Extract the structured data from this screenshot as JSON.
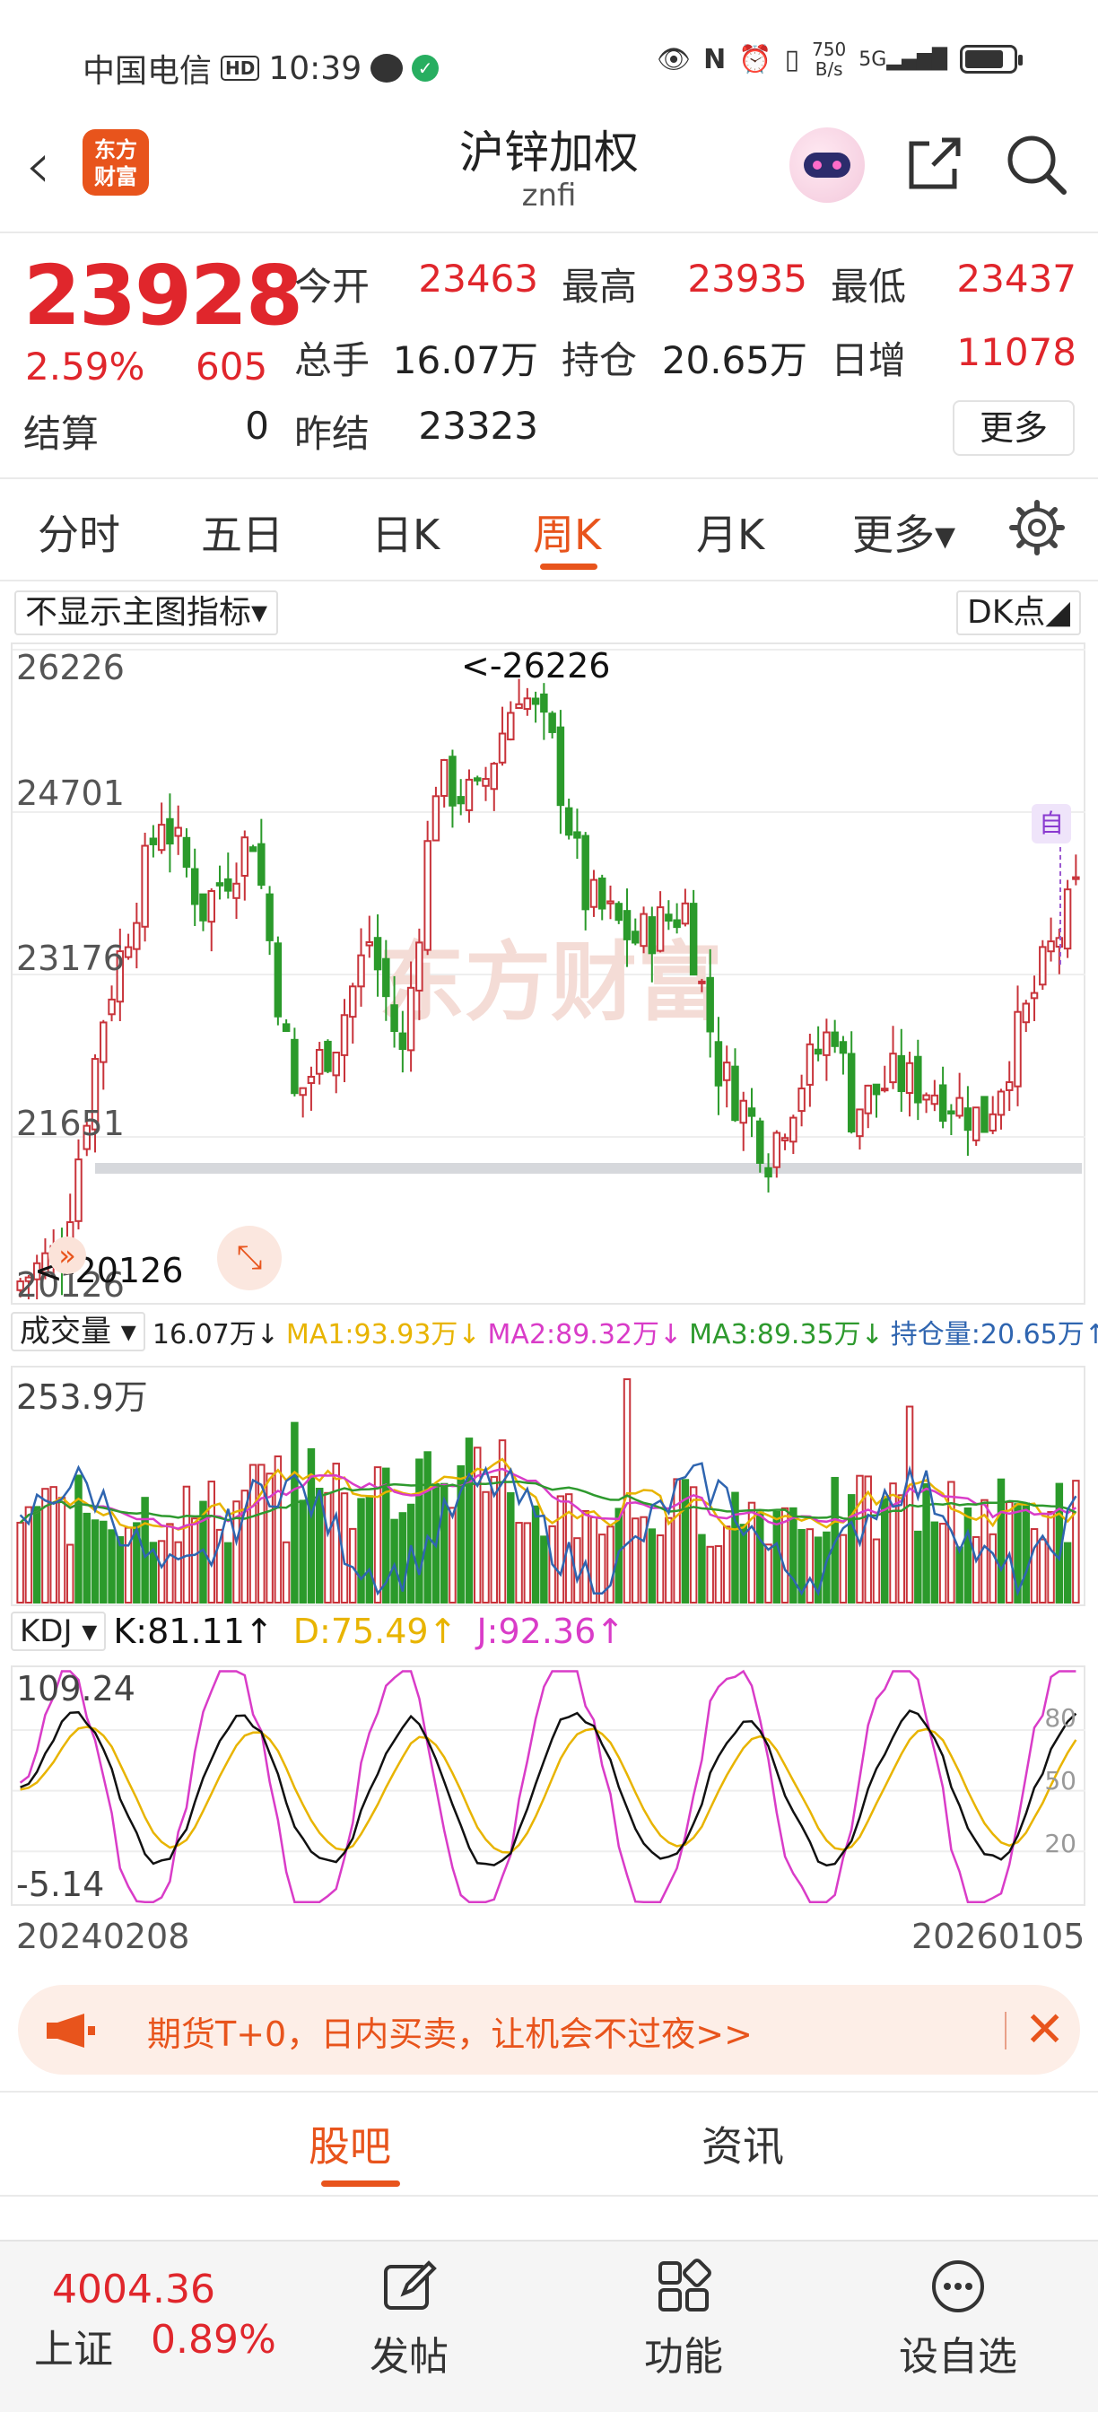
{
  "status_bar": {
    "carrier": "中国电信",
    "hd": "HD",
    "time": "10:39",
    "net_speed_value": "750",
    "net_speed_unit": "B/s",
    "signal_label": "5G"
  },
  "header": {
    "back_icon": "back-arrow-icon",
    "logo_text_line1": "东方",
    "logo_text_line2": "财富",
    "title": "沪锌加权",
    "subtitle": "znfi"
  },
  "quote": {
    "price": "23928",
    "change_pct": "2.59%",
    "change": "605",
    "open_label": "今开",
    "open": "23463",
    "high_label": "最高",
    "high": "23935",
    "low_label": "最低",
    "low": "23437",
    "volume_label": "总手",
    "volume": "16.07万",
    "oi_label": "持仓",
    "oi": "20.65万",
    "daily_inc_label": "日增",
    "daily_inc": "11078",
    "settle_label": "结算",
    "settle": "0",
    "prev_settle_label": "昨结",
    "prev_settle": "23323",
    "more_label": "更多"
  },
  "tabs": [
    {
      "label": "分时"
    },
    {
      "label": "五日"
    },
    {
      "label": "日K"
    },
    {
      "label": "周K",
      "active": true
    },
    {
      "label": "月K"
    },
    {
      "label": "更多▾"
    }
  ],
  "main_chart": {
    "indicator_dropdown": "不显示主图指标▾",
    "dk_label": "DK点◢",
    "y_ticks": [
      "26226",
      "24701",
      "23176",
      "21651",
      "20126"
    ],
    "high_annotation": "<-26226",
    "low_annotation": "<-20126",
    "self_marker": "自",
    "watermark": "东方财富"
  },
  "volume_panel": {
    "dropdown": "成交量 ▾",
    "vol": "16.07万↓",
    "ma1": "MA1:93.93万↓",
    "ma2": "MA2:89.32万↓",
    "ma3": "MA3:89.35万↓",
    "oi": "持仓量:20.65万↑",
    "y_top": "253.9万",
    "colors": {
      "ma1": "#e8b400",
      "ma2": "#d93cc8",
      "ma3": "#2e9a2e",
      "oi": "#2f65b0"
    }
  },
  "kdj_panel": {
    "dropdown": "KDJ ▾",
    "k": "K:81.11↑",
    "d": "D:75.49↑",
    "j": "J:92.36↑",
    "y_top": "109.24",
    "y_bottom": "-5.14",
    "levels": [
      "80",
      "50",
      "20"
    ]
  },
  "dates": {
    "start": "20240208",
    "end": "20260105"
  },
  "banner": {
    "text": "期货T+0，日内买卖，让机会不过夜>>",
    "close": "✕"
  },
  "subtabs": [
    {
      "label": "股吧",
      "active": true
    },
    {
      "label": "资讯"
    }
  ],
  "bottom_bar": {
    "index_value": "4004.36",
    "index_name": "上证",
    "index_pct": "0.89%",
    "items": [
      {
        "label": "发帖",
        "icon": "edit-icon"
      },
      {
        "label": "功能",
        "icon": "grid-icon"
      },
      {
        "label": "设自选",
        "icon": "more-circle-icon"
      }
    ]
  },
  "chart_data": [
    {
      "type": "candlestick",
      "title": "",
      "ylim": [
        20126,
        26226
      ],
      "x_range": [
        "20240208",
        "20260105"
      ],
      "annotations": [
        {
          "text": "<-26226",
          "value": 26226
        },
        {
          "text": "<-20126",
          "value": 20126
        }
      ],
      "colors": {
        "up": "#c8333a",
        "down": "#2b9a2b"
      }
    },
    {
      "type": "bar",
      "title": "成交量",
      "ylim": [
        0,
        253.9
      ],
      "unit": "万",
      "series": [
        {
          "name": "MA1",
          "last": 93.93
        },
        {
          "name": "MA2",
          "last": 89.32
        },
        {
          "name": "MA3",
          "last": 89.35
        },
        {
          "name": "持仓量",
          "last": 20.65
        }
      ]
    },
    {
      "type": "line",
      "title": "KDJ",
      "ylim": [
        -5.14,
        109.24
      ],
      "series": [
        {
          "name": "K",
          "last": 81.11,
          "color": "#111111"
        },
        {
          "name": "D",
          "last": 75.49,
          "color": "#e8b400"
        },
        {
          "name": "J",
          "last": 92.36,
          "color": "#d93cc8"
        }
      ]
    }
  ]
}
